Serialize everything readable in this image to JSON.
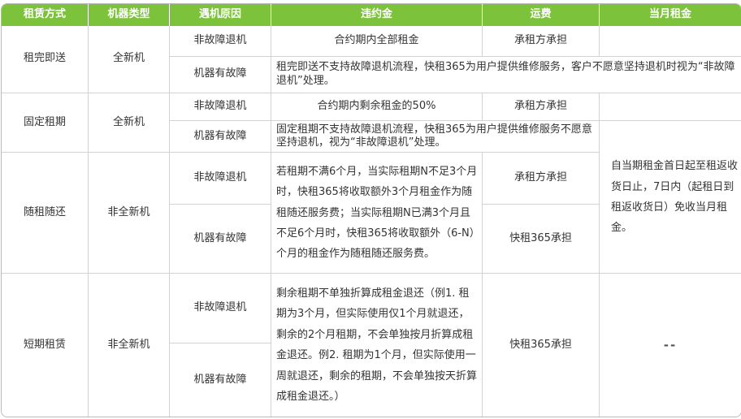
{
  "headers": [
    "租赁方式",
    "机器类型",
    "遇机原因",
    "违约金",
    "运费",
    "当月租金"
  ],
  "rows": {
    "zuwan": {
      "mode": "租完即送",
      "machine": "全新机",
      "reason1": "非故障退机",
      "penalty1": "合约期内全部租金",
      "freight1": "承租方承担",
      "reason2": "机器有故障",
      "note2": "租完即送不支持故障退机流程，快租365为用户提供维修服务，客户不愿意坚持退机时视为“非故障退机”处理。"
    },
    "guding": {
      "mode": "固定租期",
      "machine": "全新机",
      "reason1": "非故障退机",
      "penalty1": "合约期内剩余租金的50%",
      "freight1": "承租方承担",
      "reason2": "机器有故障",
      "note2": "固定租期不支持故障退机流程，快租365为用户提供维修服务不愿意坚持退机，视为“非故障退机”处理。"
    },
    "suizu": {
      "mode": "随租随还",
      "machine": "非全新机",
      "reason1": "非故障退机",
      "reason2": "机器有故障",
      "penalty": "若租期不满6个月，当实际租期N不足3个月时，快租365将收取额外3个月租金作为随租随还服务费；当实际租期N已满3个月且不足6个月时，快租365将收取额外（6-N）个月的租金作为随租随还服务费。",
      "freight1": "承租方承担",
      "freight2": "快租365承担"
    },
    "duanqi": {
      "mode": "短期租赁",
      "machine": "非全新机",
      "reason1": "非故障退机",
      "reason2": "机器有故障",
      "penalty": "剩余租期不单独折算成租金退还（例1. 租期为3个月，但实际使用仅1个月就退还，剩余的2个月租期，不会单独按月折算成租金退还。例2. 租期为1个月，但实际使用一周就退还，剩余的租期，不会单独按天折算成租金退还。）",
      "freight": "快租365承担",
      "month_rent": "--"
    }
  },
  "month_rent_note": "自当期租金首日起至租返收货日止，7日内（起租日到租返收货日）免收当月租金。"
}
